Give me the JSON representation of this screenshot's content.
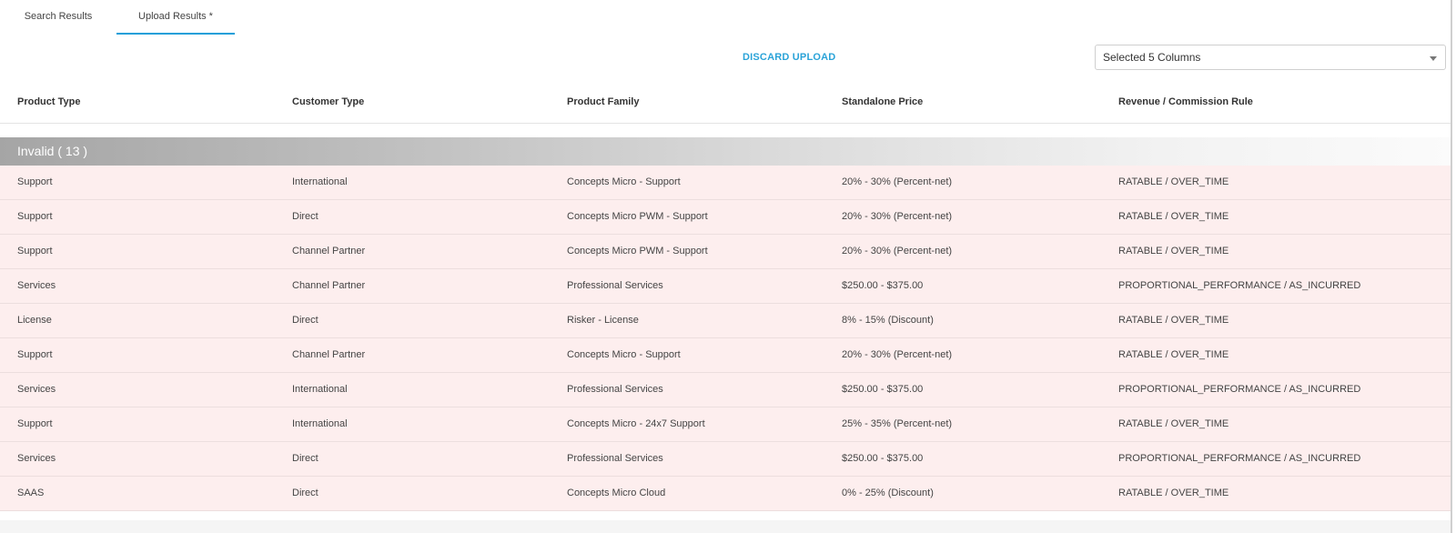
{
  "tabs": [
    {
      "label": "Search Results",
      "active": false
    },
    {
      "label": "Upload Results *",
      "active": true
    }
  ],
  "toolbar": {
    "discard_label": "DISCARD UPLOAD",
    "column_select_value": "Selected 5 Columns"
  },
  "table": {
    "columns": [
      "Product Type",
      "Customer Type",
      "Product Family",
      "Standalone Price",
      "Revenue / Commission Rule"
    ],
    "group_label": "Invalid ( 13 )",
    "rows": [
      [
        "Support",
        "International",
        "Concepts Micro - Support",
        "20% - 30% (Percent-net)",
        "RATABLE / OVER_TIME"
      ],
      [
        "Support",
        "Direct",
        "Concepts Micro PWM - Support",
        "20% - 30% (Percent-net)",
        "RATABLE / OVER_TIME"
      ],
      [
        "Support",
        "Channel Partner",
        "Concepts Micro PWM - Support",
        "20% - 30% (Percent-net)",
        "RATABLE / OVER_TIME"
      ],
      [
        "Services",
        "Channel Partner",
        "Professional Services",
        "$250.00 - $375.00",
        "PROPORTIONAL_PERFORMANCE / AS_INCURRED"
      ],
      [
        "License",
        "Direct",
        "Risker - License",
        "8% - 15% (Discount)",
        "RATABLE / OVER_TIME"
      ],
      [
        "Support",
        "Channel Partner",
        "Concepts Micro - Support",
        "20% - 30% (Percent-net)",
        "RATABLE / OVER_TIME"
      ],
      [
        "Services",
        "International",
        "Professional Services",
        "$250.00 - $375.00",
        "PROPORTIONAL_PERFORMANCE / AS_INCURRED"
      ],
      [
        "Support",
        "International",
        "Concepts Micro - 24x7 Support",
        "25% - 35% (Percent-net)",
        "RATABLE / OVER_TIME"
      ],
      [
        "Services",
        "Direct",
        "Professional Services",
        "$250.00 - $375.00",
        "PROPORTIONAL_PERFORMANCE / AS_INCURRED"
      ],
      [
        "SAAS",
        "Direct",
        "Concepts Micro Cloud",
        "0% - 25% (Discount)",
        "RATABLE / OVER_TIME"
      ]
    ]
  },
  "colors": {
    "accent": "#1a9fd9",
    "invalid_row_bg": "#fdeeee"
  },
  "icons": {
    "select_caret": "chevron-down-icon"
  }
}
